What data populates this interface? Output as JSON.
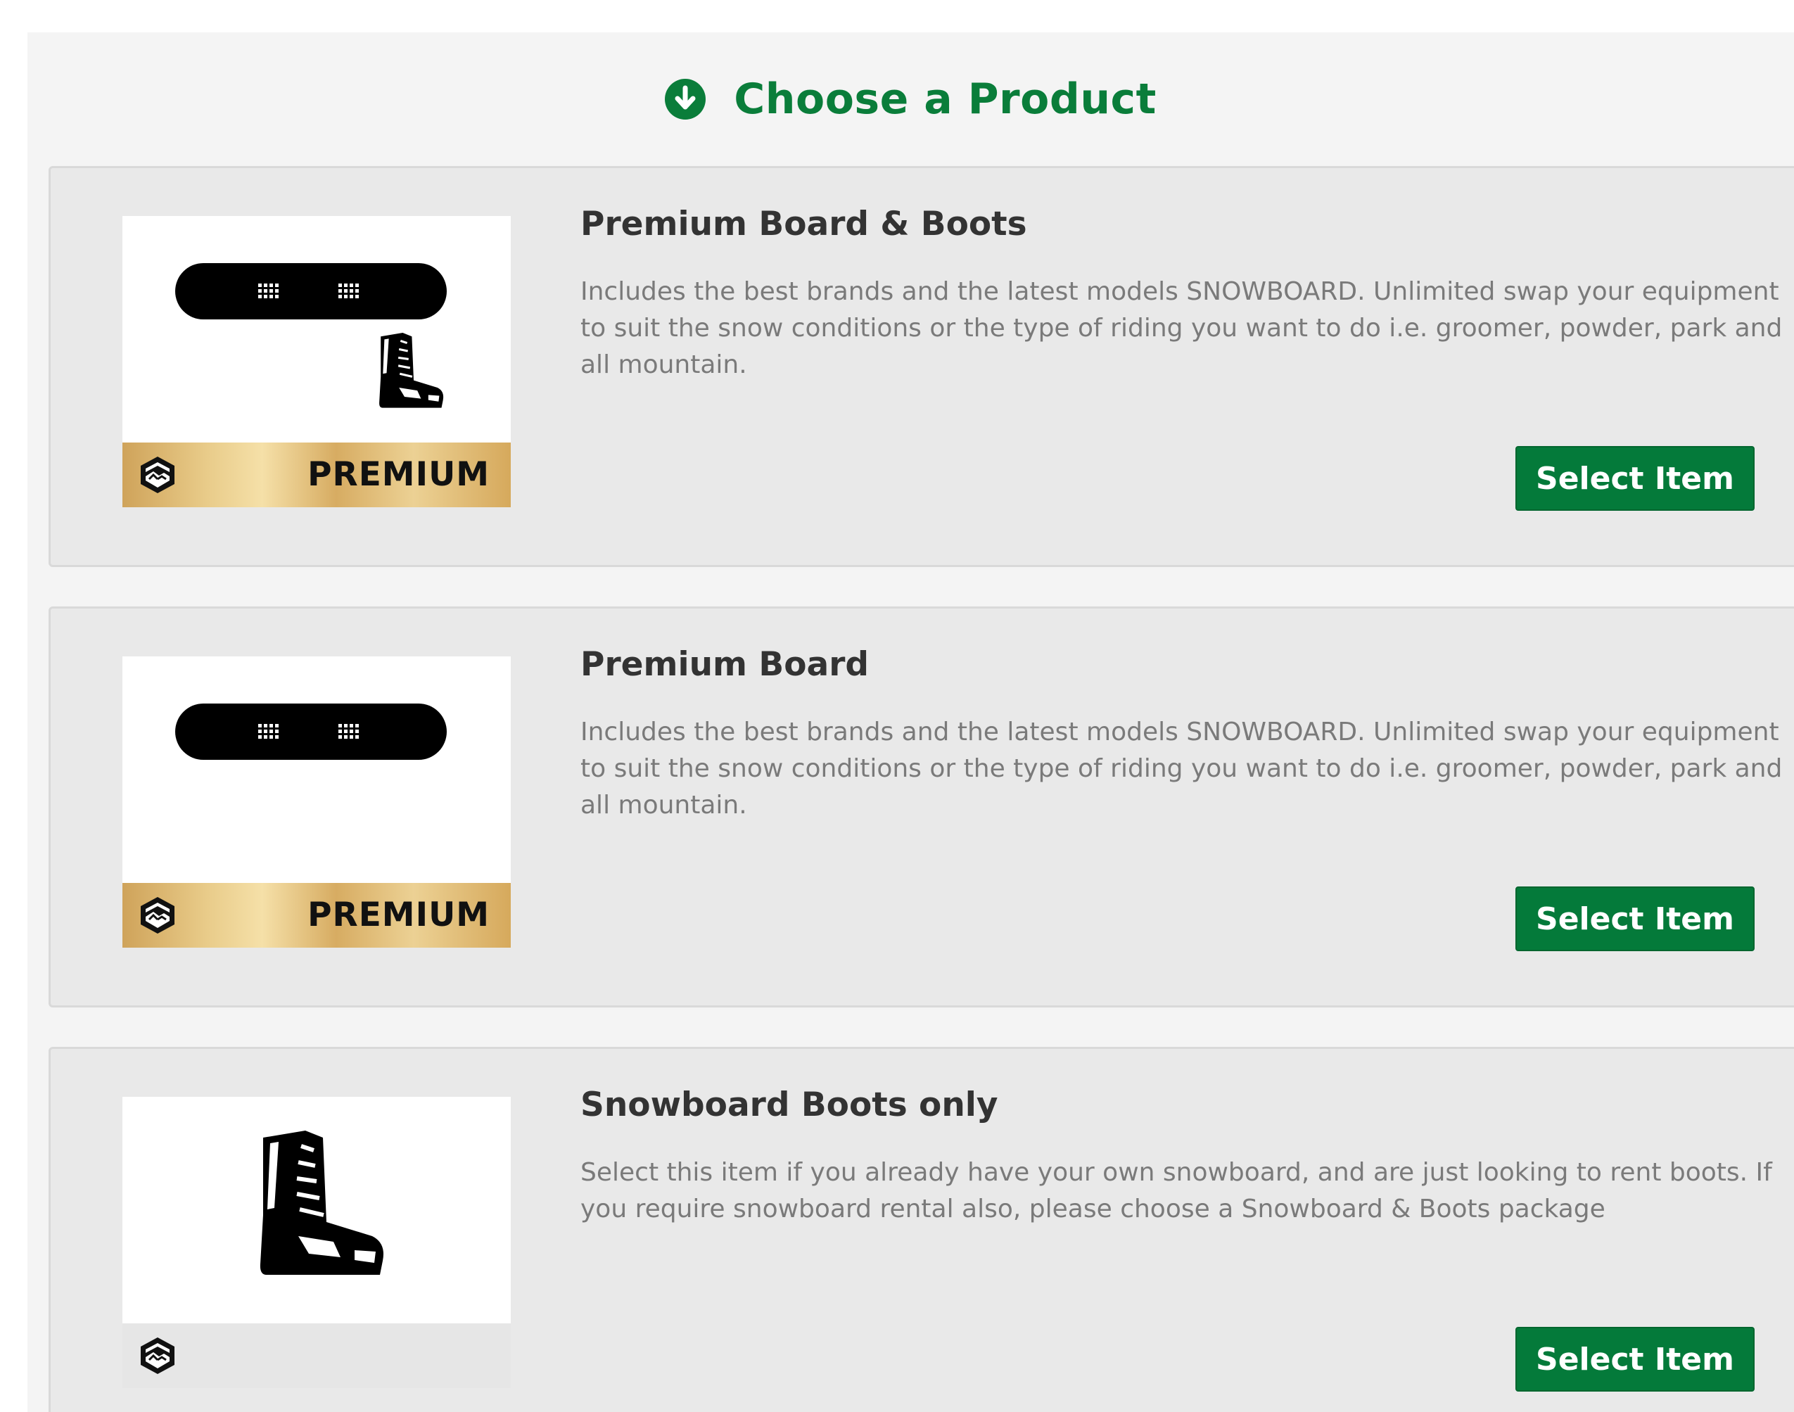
{
  "header": {
    "title": "Choose a Product",
    "icon": "arrow-down-circle-icon",
    "accent_color": "#0a7d3a"
  },
  "products": [
    {
      "title": "Premium Board & Boots",
      "description": "Includes the best brands and the latest models SNOWBOARD. Unlimited swap your equipment to suit the snow conditions or the type of riding you want to do i.e. groomer, powder, park and all mountain.",
      "tier_label": "PREMIUM",
      "image_icons": [
        "snowboard-icon",
        "boot-icon"
      ],
      "button_label": "Select Item"
    },
    {
      "title": "Premium Board",
      "description": "Includes the best brands and the latest models SNOWBOARD. Unlimited swap your equipment to suit the snow conditions or the type of riding you want to do i.e. groomer, powder, park and all mountain.",
      "tier_label": "PREMIUM",
      "image_icons": [
        "snowboard-icon"
      ],
      "button_label": "Select Item"
    },
    {
      "title": "Snowboard Boots only",
      "description": "Select this item if you already have your own snowboard, and are just looking to rent boots. If you require snowboard rental also, please choose a Snowboard & Boots package",
      "tier_label": "",
      "image_icons": [
        "boot-icon"
      ],
      "button_label": "Select Item"
    }
  ],
  "colors": {
    "button": "#047a3a",
    "premium_gold": "#d6a95c"
  }
}
